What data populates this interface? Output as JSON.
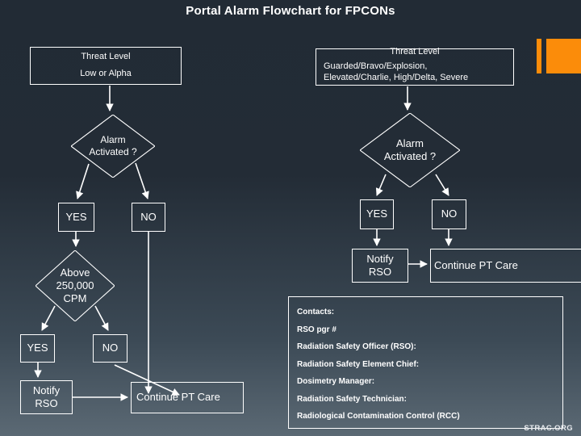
{
  "title": "Portal Alarm Flowchart for\nFPCONs",
  "decor": {
    "accent_color": "#fb8c0a",
    "bar_thin": "orange-accent-bar-thin",
    "bar_wide": "orange-accent-bar-wide"
  },
  "flow_left": {
    "threat_box": {
      "line1": "Threat Level",
      "line2": "Low or Alpha"
    },
    "decision_alarm": "Alarm\nActivated ?",
    "yes_label": "YES",
    "no_label": "NO",
    "decision_cpm": "Above\n250,000\nCPM",
    "yes_label_2": "YES",
    "no_label_2": "NO",
    "notify": "Notify\nRSO",
    "continue": "Continue PT Care"
  },
  "flow_right": {
    "threat_box": {
      "title": "Threat Level",
      "body": "Guarded/Bravo/Explosion,\nElevated/Charlie, High/Delta, Severe"
    },
    "decision_alarm": "Alarm\nActivated ?",
    "yes_label": "YES",
    "no_label": "NO",
    "notify": "Notify\nRSO",
    "continue": "Continue PT Care"
  },
  "contacts": {
    "heading": "Contacts:",
    "rows": [
      "RSO pgr #",
      "Radiation Safety Officer (RSO):",
      "Radiation Safety Element Chief:",
      "Dosimetry Manager:",
      "Radiation Safety Technician:",
      "Radiological Contamination Control (RCC)"
    ]
  },
  "footer": {
    "source": "STRAC.ORG"
  }
}
